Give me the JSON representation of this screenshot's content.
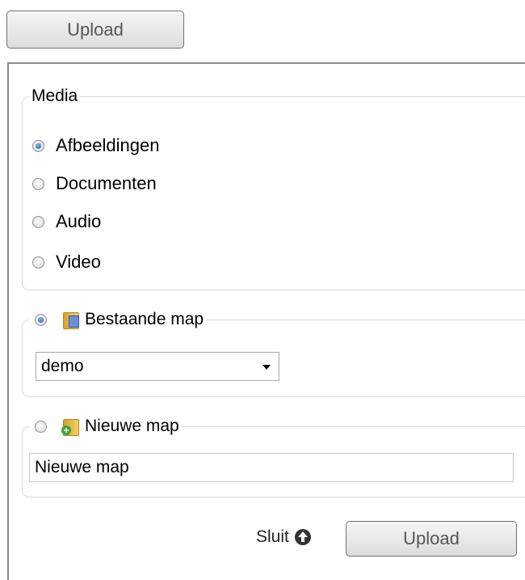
{
  "top_upload_label": "Upload",
  "media": {
    "legend": "Media",
    "options": [
      {
        "label": "Afbeeldingen",
        "selected": true
      },
      {
        "label": "Documenten",
        "selected": false
      },
      {
        "label": "Audio",
        "selected": false
      },
      {
        "label": "Video",
        "selected": false
      }
    ]
  },
  "existing_folder": {
    "legend": "Bestaande map",
    "selected": true,
    "icon": "folder-open-icon",
    "select_value": "demo"
  },
  "new_folder": {
    "legend": "Nieuwe map",
    "selected": false,
    "icon": "folder-add-icon",
    "input_value": "Nieuwe map"
  },
  "footer": {
    "close_label": "Sluit",
    "close_icon": "arrow-up-circle-icon",
    "upload_label": "Upload"
  }
}
